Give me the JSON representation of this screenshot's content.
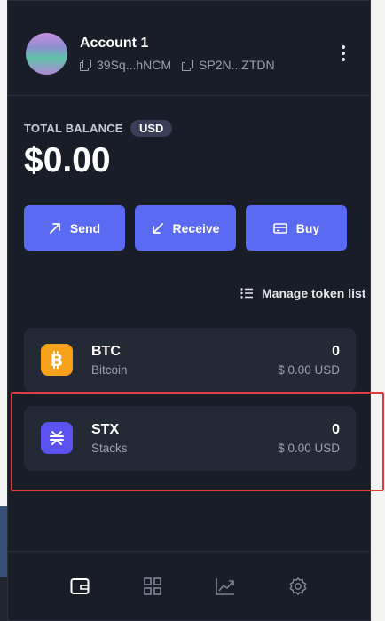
{
  "account": {
    "name": "Account 1",
    "btc_address": "39Sq...hNCM",
    "stx_address": "SP2N...ZTDN"
  },
  "balance": {
    "label": "TOTAL BALANCE",
    "currency": "USD",
    "amount": "$0.00"
  },
  "actions": [
    {
      "label": "Send",
      "icon": "arrow-up-right-icon"
    },
    {
      "label": "Receive",
      "icon": "arrow-down-left-icon"
    },
    {
      "label": "Buy",
      "icon": "card-icon"
    }
  ],
  "manage_label": "Manage token list",
  "tokens": [
    {
      "symbol": "BTC",
      "name": "Bitcoin",
      "amount": "0",
      "usd": "$ 0.00 USD",
      "color": "#f7a21b"
    },
    {
      "symbol": "STX",
      "name": "Stacks",
      "amount": "0",
      "usd": "$ 0.00 USD",
      "color": "#5b52f2"
    }
  ],
  "bottom_nav": [
    "wallet-icon",
    "grid-icon",
    "chart-icon",
    "settings-icon"
  ],
  "colors": {
    "background": "#191d27",
    "accent": "#5b6af2",
    "card": "#242936",
    "highlight": "#e23a3a"
  }
}
